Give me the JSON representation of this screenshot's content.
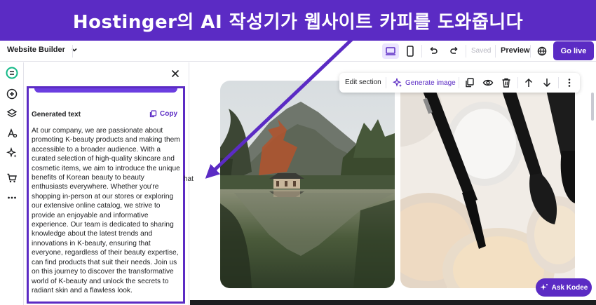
{
  "banner": {
    "text": "Hostinger의 AI 작성기가 웹사이트 카피를 도와줍니다"
  },
  "topbar": {
    "builder_label": "Website Builder",
    "saved_label": "Saved",
    "preview_label": "Preview",
    "golive_label": "Go live"
  },
  "panel": {
    "generated_label": "Generated text",
    "copy_label": "Copy",
    "generated_text": "At our company, we are passionate about promoting K-beauty products and making them accessible to a broader audience. With a curated selection of high-quality skincare and cosmetic items, we aim to introduce the unique benefits of Korean beauty to beauty enthusiasts everywhere. Whether you're shopping in-person at our stores or exploring our extensive online catalog, we strive to provide an enjoyable and informative experience. Our team is dedicated to sharing knowledge about the latest trends and innovations in K-beauty, ensuring that everyone, regardless of their beauty expertise, can find products that suit their needs. Join us on this journey to discover the transformative world of K-beauty and unlock the secrets to radiant skin and a flawless look."
  },
  "canvas": {
    "fragment_text": "hat"
  },
  "section_toolbar": {
    "edit_label": "Edit section",
    "generate_label": "Generate image"
  },
  "kodee": {
    "label": "Ask Kodee"
  },
  "colors": {
    "brand": "#5b2bc4",
    "brand_light": "#ebe4ff",
    "text": "#1d1e20"
  },
  "icons": [
    "chevron-down-icon",
    "desktop-icon",
    "mobile-icon",
    "undo-icon",
    "redo-icon",
    "globe-icon",
    "logo-icon",
    "add-icon",
    "layers-icon",
    "styles-icon",
    "ai-tools-icon",
    "store-icon",
    "more-icon",
    "close-icon",
    "copy-icon",
    "sparkle-icon",
    "duplicate-icon",
    "eye-icon",
    "trash-icon",
    "arrow-up-icon",
    "arrow-down-icon",
    "kebab-icon"
  ]
}
